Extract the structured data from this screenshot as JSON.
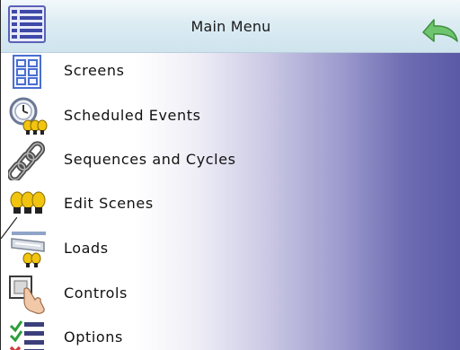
{
  "header": {
    "title": "Main Menu",
    "menu_icon": "list-icon",
    "back_icon": "back-arrow-icon"
  },
  "menu": {
    "items": [
      {
        "label": "Screens",
        "icon": "screens-icon"
      },
      {
        "label": "Scheduled Events",
        "icon": "scheduled-events-icon"
      },
      {
        "label": "Sequences and Cycles",
        "icon": "chain-icon"
      },
      {
        "label": "Edit Scenes",
        "icon": "bulbs-icon"
      },
      {
        "label": "Loads",
        "icon": "loads-icon"
      },
      {
        "label": "Controls",
        "icon": "touch-hand-icon"
      },
      {
        "label": "Options",
        "icon": "checklist-icon"
      }
    ]
  },
  "colors": {
    "title_bar": "#dcecf3",
    "gradient_end": "#5a59a6",
    "bulb": "#f1c40f",
    "back_arrow": "#5cb85c"
  }
}
